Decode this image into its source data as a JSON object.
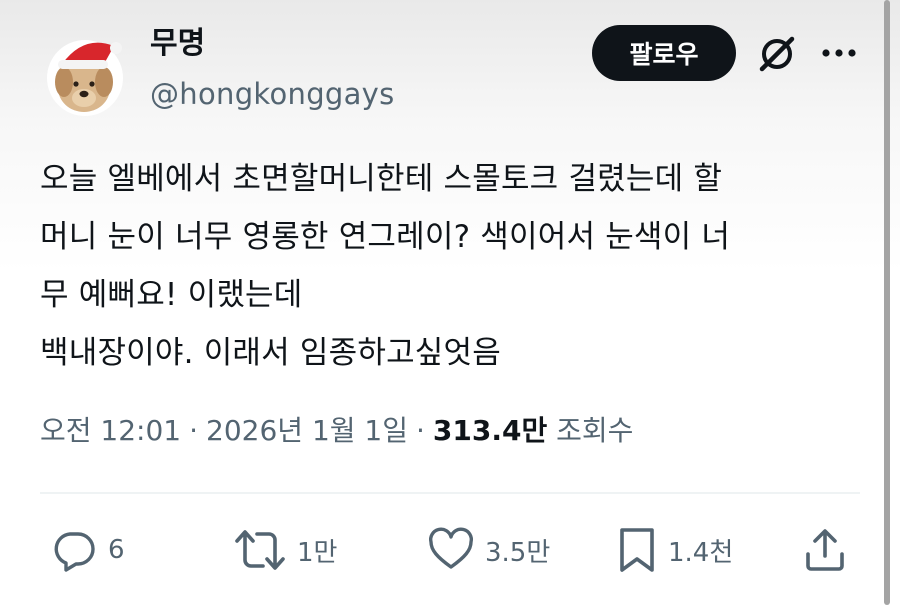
{
  "author": {
    "name": "무명",
    "handle": "@hongkonggays"
  },
  "header": {
    "follow_label": "팔로우",
    "grok_icon": "grok-icon",
    "more_icon": "more-dots-icon"
  },
  "tweet": {
    "lines": [
      "오늘 엘베에서 초면할머니한테 스몰토크 걸렸는데 할",
      "머니 눈이 너무 영롱한 연그레이? 색이어서 눈색이 너",
      "무 예뻐요! 이랬는데",
      "백내장이야. 이래서 임종하고싶엇음"
    ]
  },
  "meta": {
    "time": "오전 12:01",
    "separator": "·",
    "date": "2026년 1월 1일",
    "views_count": "313.4만",
    "views_label": "조회수"
  },
  "actions": {
    "reply": {
      "icon": "reply-icon",
      "count": "6"
    },
    "retweet": {
      "icon": "retweet-icon",
      "count": "1만"
    },
    "like": {
      "icon": "heart-icon",
      "count": "3.5만"
    },
    "bookmark": {
      "icon": "bookmark-icon",
      "count": "1.4천"
    },
    "share": {
      "icon": "share-icon"
    }
  },
  "colors": {
    "text": "#0f1419",
    "secondary": "#536471",
    "button_bg": "#0f1419",
    "divider": "#eff3f4"
  }
}
